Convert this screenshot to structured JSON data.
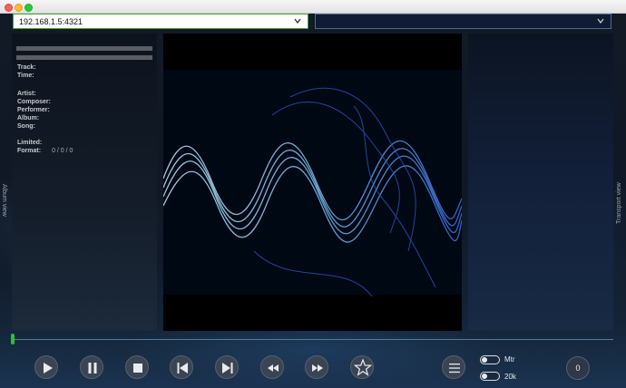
{
  "window": {
    "buttons": [
      "close",
      "minimize",
      "zoom"
    ]
  },
  "toolbar": {
    "server_address": "192.168.1.5:4321",
    "second_select_value": ""
  },
  "left_panel": {
    "side_label": "Album view",
    "fields": [
      {
        "label": "Track:",
        "value": ""
      },
      {
        "label": "Time:",
        "value": ""
      },
      {
        "label": "Artist:",
        "value": ""
      },
      {
        "label": "Composer:",
        "value": ""
      },
      {
        "label": "Performer:",
        "value": ""
      },
      {
        "label": "Album:",
        "value": ""
      },
      {
        "label": "Song:",
        "value": ""
      },
      {
        "label": "Limited:",
        "value": ""
      },
      {
        "label": "Format:",
        "value": "0 / 0 / 0"
      }
    ]
  },
  "right_panel": {
    "side_label": "Transport view"
  },
  "transport": {
    "seek_position": 0.0,
    "buttons": [
      "play",
      "pause",
      "stop",
      "previous-track",
      "next-track",
      "rewind",
      "fast-forward",
      "favorite",
      "playlist-menu"
    ],
    "toggles": [
      {
        "label": "Mtr",
        "on": false
      },
      {
        "label": "20k",
        "on": false
      }
    ],
    "counter": "0"
  },
  "colors": {
    "accent_green": "#29c236",
    "background": "#121a26",
    "waveform": "#4d7fd9"
  },
  "album_art": {
    "description_icon": "waveform-art"
  }
}
